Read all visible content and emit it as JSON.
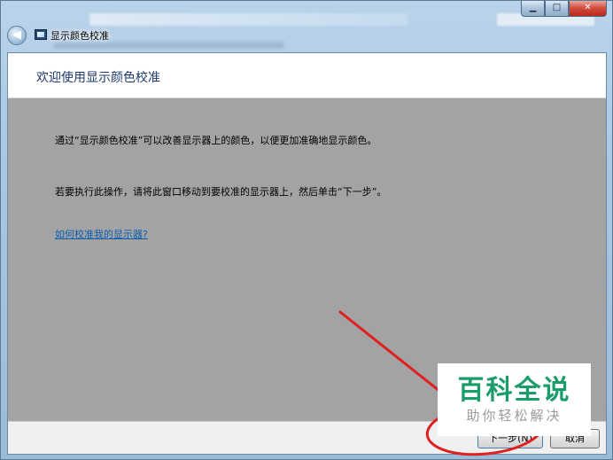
{
  "window": {
    "title": "显示颜色校准",
    "minimize_glyph": "▁",
    "maximize_glyph": "□",
    "close_glyph": "✕"
  },
  "page": {
    "heading": "欢迎使用显示颜色校准",
    "paragraph1": "通过“显示颜色校准”可以改善显示器上的颜色，以便更加准确地显示颜色。",
    "paragraph2": "若要执行此操作，请将此窗口移动到要校准的显示器上，然后单击“下一步”。",
    "help_link": "如何校准我的显示器?"
  },
  "footer": {
    "next_label": "下一步(N)",
    "cancel_label": "取消"
  },
  "watermark": {
    "title": "百科全说",
    "subtitle": "助你轻松解决"
  },
  "colors": {
    "content_bg": "#a3a3a3",
    "link": "#0b5fb0",
    "annotation": "#e02020",
    "watermark_green": "#1a9d6a"
  }
}
